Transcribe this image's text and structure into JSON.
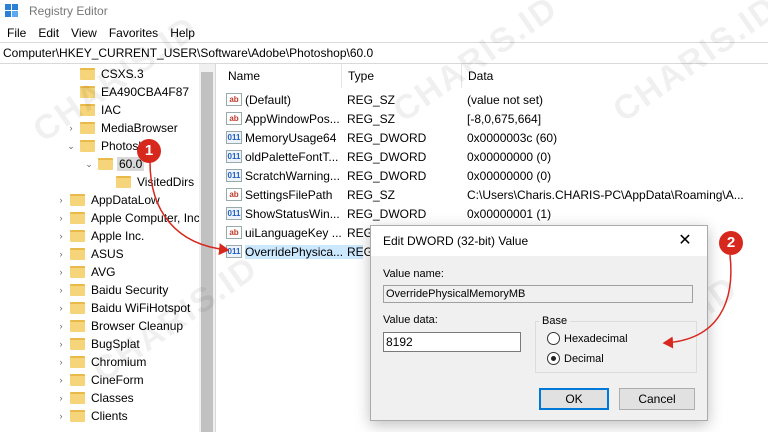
{
  "window": {
    "title": "Registry Editor"
  },
  "menu": [
    "File",
    "Edit",
    "View",
    "Favorites",
    "Help"
  ],
  "address": "Computer\\HKEY_CURRENT_USER\\Software\\Adobe\\Photoshop\\60.0",
  "tree": [
    {
      "label": "CSXS.3",
      "chevron": ""
    },
    {
      "label": "EA490CBA4F87",
      "chevron": ""
    },
    {
      "label": "IAC",
      "chevron": ""
    },
    {
      "label": "MediaBrowser",
      "chevron": "›"
    },
    {
      "label": "Photoshop",
      "chevron": "⌄"
    },
    {
      "label": "60.0",
      "chevron": "⌄"
    },
    {
      "label": "VisitedDirs",
      "chevron": ""
    },
    {
      "label": "AppDataLow",
      "chevron": "›"
    },
    {
      "label": "Apple Computer, Inc",
      "chevron": "›"
    },
    {
      "label": "Apple Inc.",
      "chevron": "›"
    },
    {
      "label": "ASUS",
      "chevron": "›"
    },
    {
      "label": "AVG",
      "chevron": "›"
    },
    {
      "label": "Baidu Security",
      "chevron": "›"
    },
    {
      "label": "Baidu WiFiHotspot",
      "chevron": "›"
    },
    {
      "label": "Browser Cleanup",
      "chevron": "›"
    },
    {
      "label": "BugSplat",
      "chevron": "›"
    },
    {
      "label": "Chromium",
      "chevron": "›"
    },
    {
      "label": "CineForm",
      "chevron": "›"
    },
    {
      "label": "Classes",
      "chevron": "›"
    },
    {
      "label": "Clients",
      "chevron": "›"
    }
  ],
  "columns": {
    "name": "Name",
    "type": "Type",
    "data": "Data"
  },
  "values": [
    {
      "icon": "ab",
      "name": "(Default)",
      "type": "REG_SZ",
      "data": "(value not set)"
    },
    {
      "icon": "ab",
      "name": "AppWindowPos...",
      "type": "REG_SZ",
      "data": "[-8,0,675,664]"
    },
    {
      "icon": "011",
      "name": "MemoryUsage64",
      "type": "REG_DWORD",
      "data": "0x0000003c (60)"
    },
    {
      "icon": "011",
      "name": "oldPaletteFontT...",
      "type": "REG_DWORD",
      "data": "0x00000000 (0)"
    },
    {
      "icon": "011",
      "name": "ScratchWarning...",
      "type": "REG_DWORD",
      "data": "0x00000000 (0)"
    },
    {
      "icon": "ab",
      "name": "SettingsFilePath",
      "type": "REG_SZ",
      "data": "C:\\Users\\Charis.CHARIS-PC\\AppData\\Roaming\\A..."
    },
    {
      "icon": "011",
      "name": "ShowStatusWin...",
      "type": "REG_DWORD",
      "data": "0x00000001 (1)"
    },
    {
      "icon": "ab",
      "name": "uiLanguageKey ...",
      "type": "REG_",
      "data": ""
    },
    {
      "icon": "011",
      "name": "OverridePhysica...",
      "type": "REG_",
      "data": ""
    }
  ],
  "dialog": {
    "title": "Edit DWORD (32-bit) Value",
    "value_name_label": "Value name:",
    "value_name": "OverridePhysicalMemoryMB",
    "value_data_label": "Value data:",
    "value_data": "8192",
    "base_label": "Base",
    "hex_label": "Hexadecimal",
    "dec_label": "Decimal",
    "selected_base": "Decimal",
    "ok": "OK",
    "cancel": "Cancel",
    "close": "✕"
  },
  "badges": {
    "one": "1",
    "two": "2"
  },
  "watermark": "CHARIS.ID",
  "colors": {
    "badge": "#d7281e",
    "selection": "#cce8ff",
    "dialog_bg": "#f0f0f0"
  }
}
